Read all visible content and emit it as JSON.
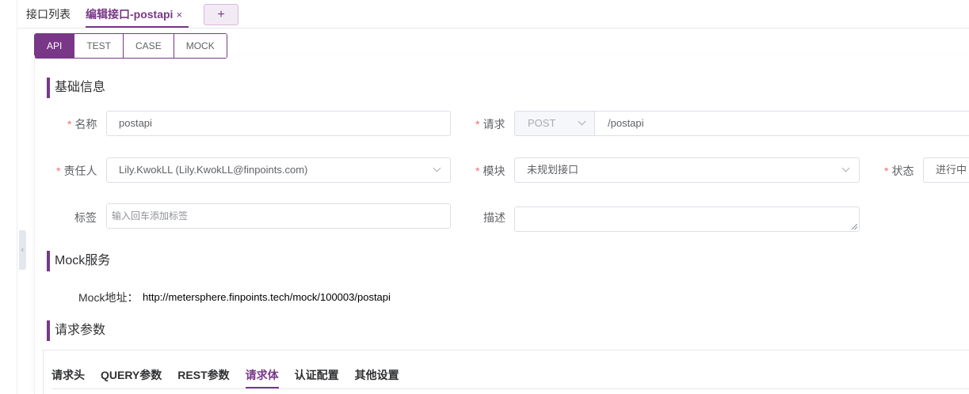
{
  "top_tabs": {
    "list_label": "接口列表",
    "active_label": "编辑接口-postapi",
    "close_glyph": "×",
    "add_glyph": "+"
  },
  "sub_tabs": [
    {
      "label": "API",
      "active": true
    },
    {
      "label": "TEST",
      "active": false
    },
    {
      "label": "CASE",
      "active": false
    },
    {
      "label": "MOCK",
      "active": false
    }
  ],
  "basic": {
    "title": "基础信息",
    "name_label": "名称",
    "name_value": "postapi",
    "request_label": "请求",
    "method_value": "POST",
    "path_value": "/postapi",
    "owner_label": "责任人",
    "owner_value": "Lily.KwokLL (Lily.KwokLL@finpoints.com)",
    "module_label": "模块",
    "module_value": "未规划接口",
    "status_label": "状态",
    "status_value": "进行中",
    "tag_label": "标签",
    "tag_placeholder": "输入回车添加标签",
    "desc_label": "描述",
    "required_mark": "*"
  },
  "mock": {
    "title": "Mock服务",
    "address_label": "Mock地址：",
    "address_value": "http://metersphere.finpoints.tech/mock/100003/postapi"
  },
  "params": {
    "title": "请求参数",
    "tabs": [
      {
        "label": "请求头",
        "active": false
      },
      {
        "label": "QUERY参数",
        "active": false
      },
      {
        "label": "REST参数",
        "active": false
      },
      {
        "label": "请求体",
        "active": true
      },
      {
        "label": "认证配置",
        "active": false
      },
      {
        "label": "其他设置",
        "active": false
      }
    ]
  },
  "colors": {
    "accent": "#783887",
    "required": "#f56c6c"
  }
}
